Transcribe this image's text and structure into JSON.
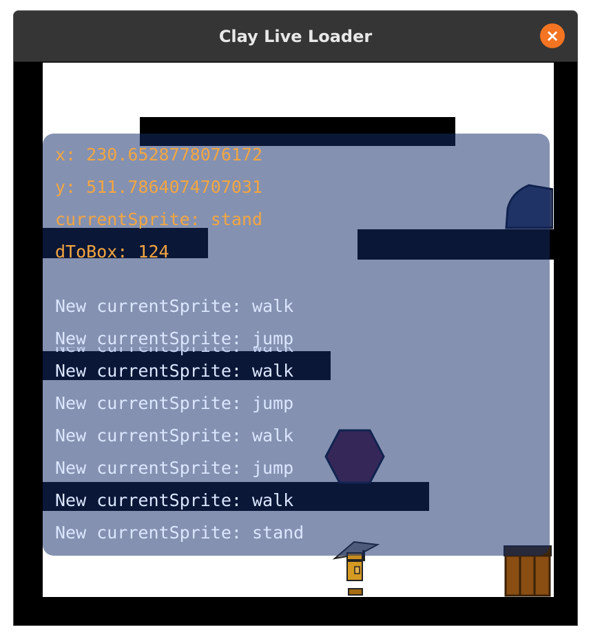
{
  "window": {
    "title": "Clay Live Loader",
    "close_label": "×"
  },
  "colors": {
    "close_button": "#f47421",
    "stat_text": "#f4a640",
    "log_text": "#dbe6ff",
    "hexagon": "#5a2545",
    "crate": "#8a4d12",
    "rock": "#3c4a6e"
  },
  "debug": {
    "stats": [
      "x: 230.6528778076172",
      "y: 511.7864074707031",
      "currentSprite: stand",
      "dToBox: 124"
    ],
    "log": [
      "New currentSprite: walk",
      "New currentSprite: jump",
      "New currentSprite: walk",
      "New currentSprite: jump",
      "New currentSprite: walk",
      "New currentSprite: jump",
      "New currentSprite: walk",
      "New currentSprite: stand"
    ]
  }
}
